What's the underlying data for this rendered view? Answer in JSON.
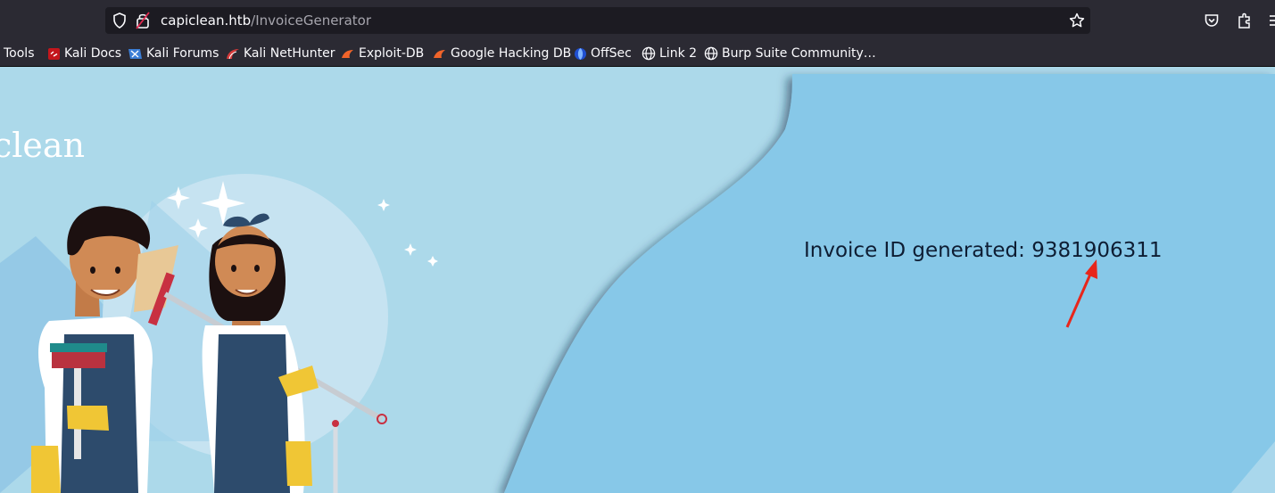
{
  "browser": {
    "url_host": "capiclean.htb",
    "url_path": "/InvoiceGenerator",
    "bookmarks": [
      {
        "label": "Tools"
      },
      {
        "label": "Kali Docs"
      },
      {
        "label": "Kali Forums"
      },
      {
        "label": "Kali NetHunter"
      },
      {
        "label": "Exploit-DB"
      },
      {
        "label": "Google Hacking DB"
      },
      {
        "label": "OffSec"
      },
      {
        "label": "Link 2"
      },
      {
        "label": "Burp Suite Community…"
      }
    ]
  },
  "page": {
    "logo_text": "clean",
    "message_prefix": "Invoice ID generated: ",
    "invoice_id": "9381906311"
  },
  "colors": {
    "browser_chrome": "#2b2a33",
    "urlbar_bg": "#1c1b22",
    "page_bg": "#acd9ea",
    "panel_bg": "#87c8e8",
    "annotation_arrow": "#e8261b"
  }
}
